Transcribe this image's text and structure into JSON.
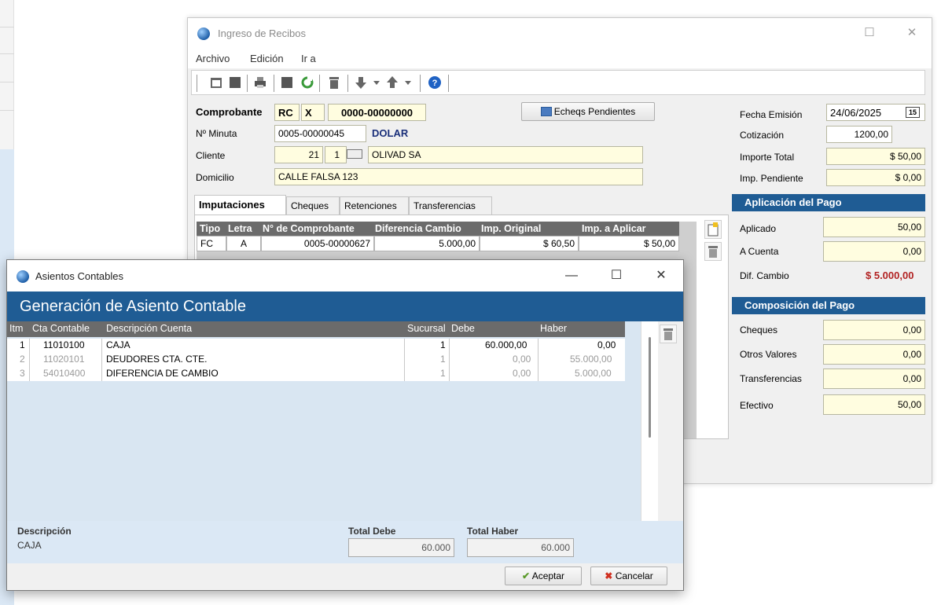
{
  "main_window": {
    "title": "Ingreso de Recibos",
    "menu": [
      "Archivo",
      "Edición",
      "Ir a"
    ],
    "comprobante": {
      "label": "Comprobante",
      "tipo": "RC",
      "letra": "X",
      "numero": "0000-00000000"
    },
    "echeqs_button": "Echeqs Pendientes",
    "minuta": {
      "label": "Nº Minuta",
      "value": "0005-00000045",
      "moneda": "DOLAR"
    },
    "cliente": {
      "label": "Cliente",
      "codigo": "21",
      "sub": "1",
      "nombre": "OLIVAD SA"
    },
    "domicilio": {
      "label": "Domicilio",
      "value": "CALLE FALSA 123"
    },
    "fecha_emision": {
      "label": "Fecha Emisión",
      "value": "24/06/2025"
    },
    "cotizacion": {
      "label": "Cotización",
      "value": "1200,00"
    },
    "importe_total": {
      "label": "Importe Total",
      "value": "$ 50,00"
    },
    "imp_pendiente": {
      "label": "Imp. Pendiente",
      "value": "$ 0,00"
    },
    "tabs": [
      "Imputaciones",
      "Cheques",
      "Retenciones",
      "Transferencias"
    ],
    "imputaciones": {
      "headers": [
        "Tipo",
        "Letra",
        "N° de Comprobante",
        "Diferencia Cambio",
        "Imp. Original",
        "Imp. a Aplicar"
      ],
      "rows": [
        [
          "FC",
          "A",
          "0005-00000627",
          "5.000,00",
          "$ 60,50",
          "$ 50,00"
        ]
      ]
    },
    "aplicacion": {
      "title": "Aplicación del Pago",
      "aplicado": {
        "label": "Aplicado",
        "value": "50,00"
      },
      "a_cuenta": {
        "label": "A Cuenta",
        "value": "0,00"
      },
      "dif_cambio": {
        "label": "Dif. Cambio",
        "value": "$ 5.000,00"
      }
    },
    "composicion": {
      "title": "Composición del Pago",
      "cheques": {
        "label": "Cheques",
        "value": "0,00"
      },
      "otros_valores": {
        "label": "Otros Valores",
        "value": "0,00"
      },
      "transferencias": {
        "label": "Transferencias",
        "value": "0,00"
      },
      "efectivo": {
        "label": "Efectivo",
        "value": "50,00"
      }
    }
  },
  "dialog": {
    "title": "Asientos Contables",
    "banner": "Generación de Asiento Contable",
    "headers": [
      "Itm",
      "Cta Contable",
      "Descripción Cuenta",
      "Sucursal",
      "Debe",
      "Haber"
    ],
    "rows": [
      [
        "1",
        "11010100",
        "CAJA",
        "1",
        "60.000,00",
        "0,00"
      ],
      [
        "2",
        "11020101",
        "DEUDORES CTA. CTE.",
        "1",
        "0,00",
        "55.000,00"
      ],
      [
        "3",
        "54010400",
        "DIFERENCIA DE CAMBIO",
        "1",
        "0,00",
        "5.000,00"
      ]
    ],
    "descripcion_label": "Descripción",
    "descripcion_value": "CAJA",
    "total_debe_label": "Total Debe",
    "total_debe": "60.000",
    "total_haber_label": "Total Haber",
    "total_haber": "60.000",
    "aceptar": "Aceptar",
    "cancelar": "Cancelar"
  },
  "colors": {
    "accent": "#1f5c94",
    "field_yellow": "#fffde0",
    "grid_header": "#6b6b6b",
    "dif_cambio": "#b22222"
  }
}
